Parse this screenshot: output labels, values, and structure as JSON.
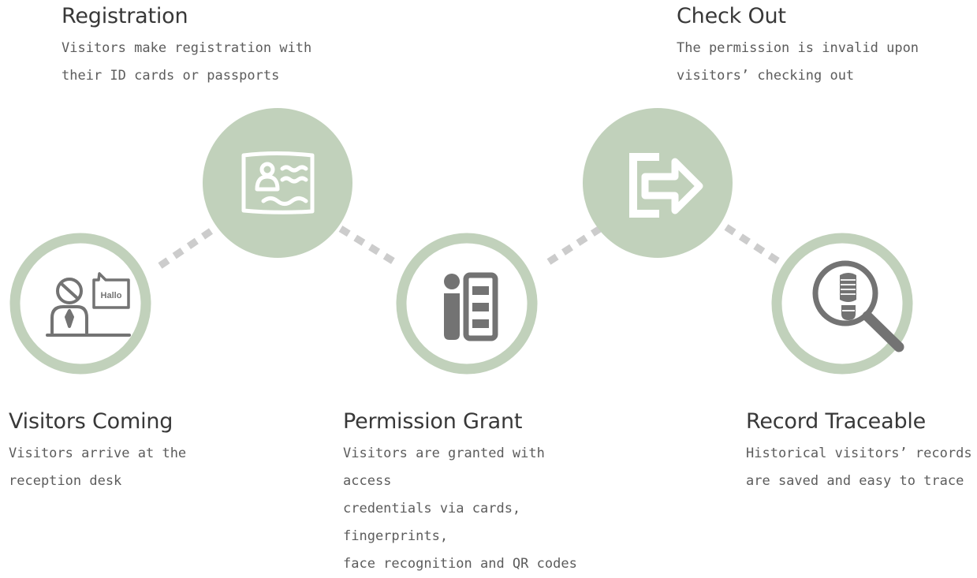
{
  "colors": {
    "circle_fill": "#c1d1bb",
    "ring_stroke": "#c1d1bb",
    "connector": "#cccccc",
    "icon_gray": "#737373",
    "icon_white": "#ffffff"
  },
  "steps": {
    "registration": {
      "title": "Registration",
      "desc_lines": [
        "Visitors make registration with",
        "their ID cards or passports"
      ],
      "icon": "id-card-icon"
    },
    "checkout": {
      "title": "Check Out",
      "desc_lines": [
        "The permission is invalid upon",
        "visitors’ checking out"
      ],
      "icon": "exit-arrow-icon"
    },
    "visitors": {
      "title": "Visitors Coming",
      "desc_lines": [
        "Visitors arrive at the",
        "reception desk"
      ],
      "icon": "receptionist-icon",
      "speech_text": "Hallo"
    },
    "permission": {
      "title": "Permission Grant",
      "desc_lines": [
        "Visitors are granted with access",
        "credentials via cards, fingerprints,",
        "face recognition and QR codes"
      ],
      "icon": "person-card-icon"
    },
    "record": {
      "title": "Record Traceable",
      "desc_lines": [
        "Historical visitors’ records",
        "are saved and easy to trace"
      ],
      "icon": "footprint-magnifier-icon"
    }
  }
}
